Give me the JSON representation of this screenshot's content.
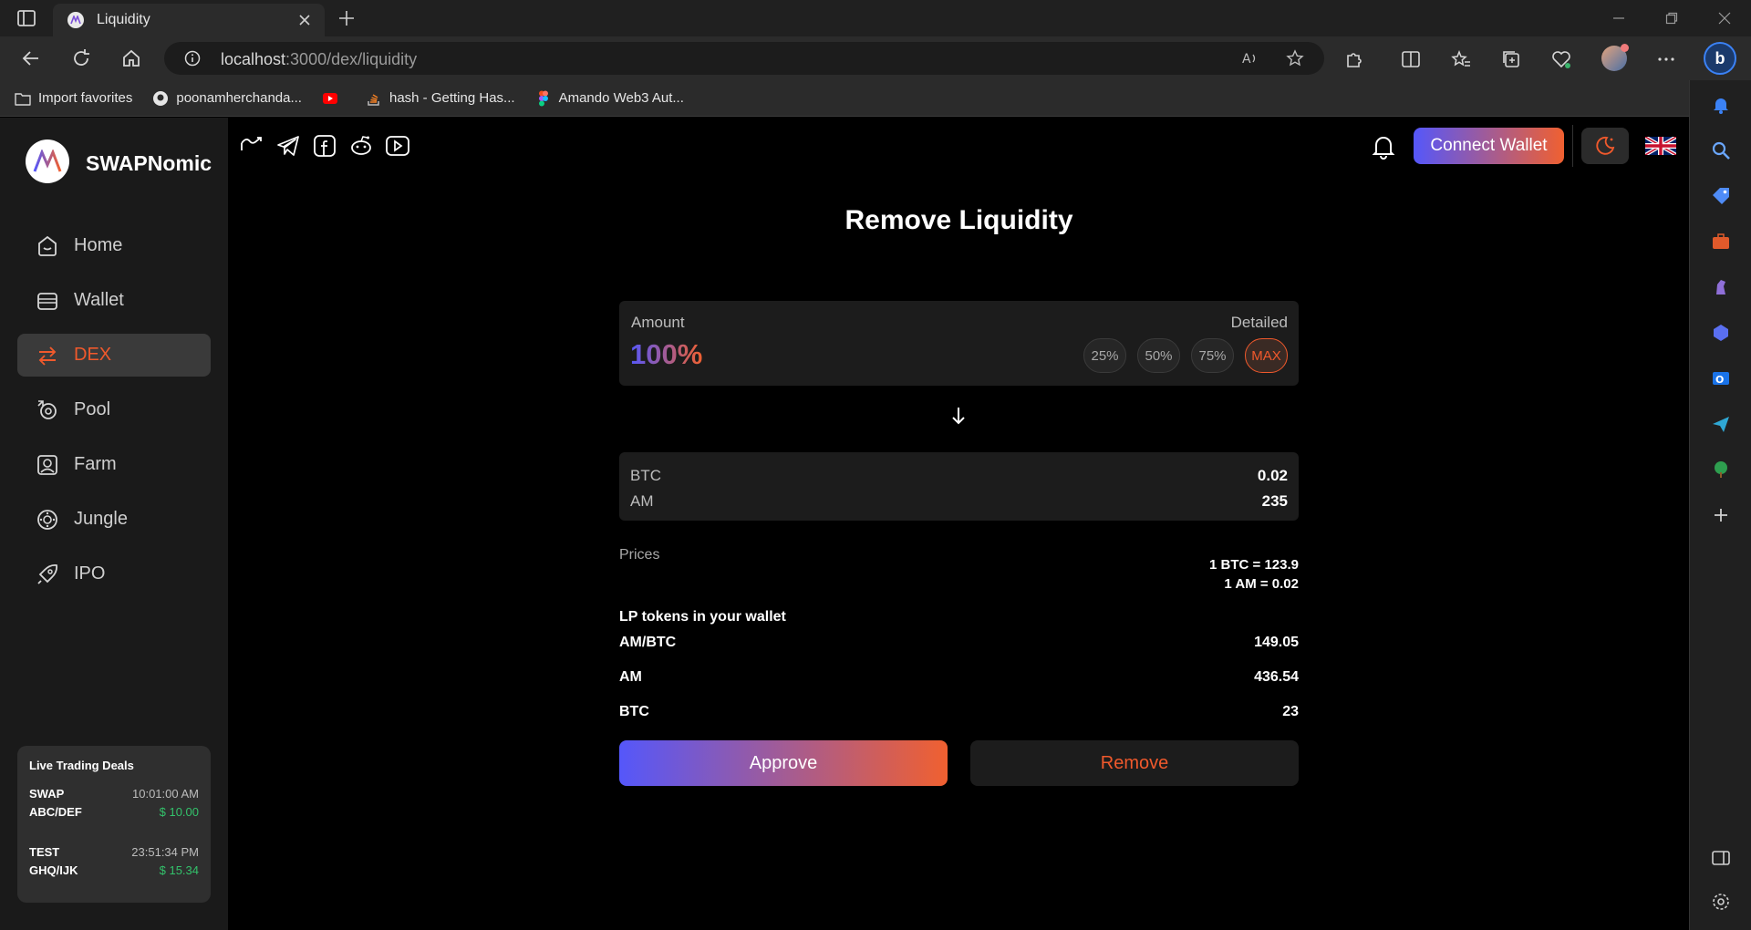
{
  "browser": {
    "tab_title": "Liquidity",
    "url_host": "localhost",
    "url_path": ":3000/dex/liquidity",
    "favorites": [
      {
        "label": "Import favorites",
        "icon": "folder-import-icon"
      },
      {
        "label": "poonamherchanda...",
        "icon": "github-icon"
      },
      {
        "label": "",
        "icon": "youtube-icon"
      },
      {
        "label": "hash - Getting Has...",
        "icon": "stackoverflow-icon"
      },
      {
        "label": "Amando Web3 Aut...",
        "icon": "figma-icon"
      }
    ]
  },
  "app": {
    "brand": "SWAPNomic",
    "nav": [
      {
        "label": "Home",
        "icon": "home-icon",
        "active": false
      },
      {
        "label": "Wallet",
        "icon": "wallet-icon",
        "active": false
      },
      {
        "label": "DEX",
        "icon": "swap-arrows-icon",
        "active": true
      },
      {
        "label": "Pool",
        "icon": "pool-icon",
        "active": false
      },
      {
        "label": "Farm",
        "icon": "farm-icon",
        "active": false
      },
      {
        "label": "Jungle",
        "icon": "jungle-icon",
        "active": false
      },
      {
        "label": "IPO",
        "icon": "rocket-icon",
        "active": false
      }
    ],
    "deals": {
      "title": "Live Trading Deals",
      "items": [
        {
          "type": "SWAP",
          "time": "10:01:00 AM",
          "pair": "ABC/DEF",
          "price": "$ 10.00"
        },
        {
          "type": "TEST",
          "time": "23:51:34 PM",
          "pair": "GHQ/IJK",
          "price": "$ 15.34"
        }
      ]
    },
    "connect_label": "Connect Wallet",
    "accent": "#f0592c",
    "gradient": [
      "#5557fa",
      "#f06030"
    ]
  },
  "main": {
    "title": "Remove Liquidity",
    "amount_label": "Amount",
    "detailed_label": "Detailed",
    "amount_value": "100%",
    "pct_buttons": [
      "25%",
      "50%",
      "75%",
      "MAX"
    ],
    "tokens": [
      {
        "name": "BTC",
        "value": "0.02"
      },
      {
        "name": "AM",
        "value": "235"
      }
    ],
    "prices_label": "Prices",
    "prices": [
      "1 BTC = 123.9",
      "1 AM = 0.02"
    ],
    "lp_title": "LP tokens in your wallet",
    "lp": [
      {
        "name": "AM/BTC",
        "value": "149.05"
      },
      {
        "name": "AM",
        "value": "436.54"
      },
      {
        "name": "BTC",
        "value": "23"
      }
    ],
    "approve_label": "Approve",
    "remove_label": "Remove"
  }
}
